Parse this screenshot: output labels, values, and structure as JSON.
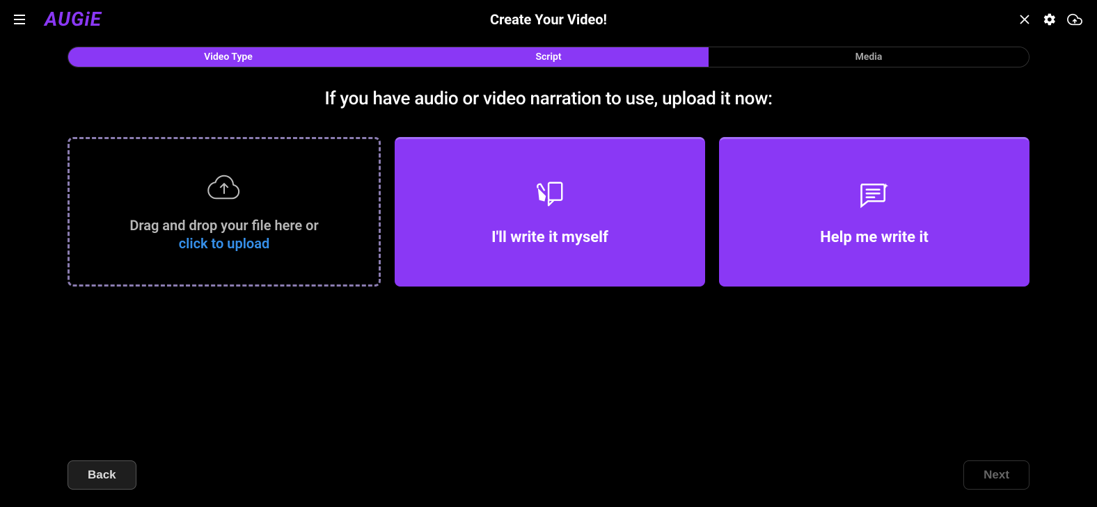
{
  "header": {
    "logo": "AUGiE",
    "title": "Create Your Video!"
  },
  "steps": [
    {
      "label": "Video Type",
      "active": true
    },
    {
      "label": "Script",
      "active": true
    },
    {
      "label": "Media",
      "active": false
    }
  ],
  "prompt": "If you have audio or video narration to use, upload it now:",
  "upload": {
    "text_main": "Drag and drop your file here or",
    "text_link": "click to upload"
  },
  "options": {
    "write_myself": "I'll write it myself",
    "help_write": "Help me write it"
  },
  "footer": {
    "back": "Back",
    "next": "Next"
  }
}
